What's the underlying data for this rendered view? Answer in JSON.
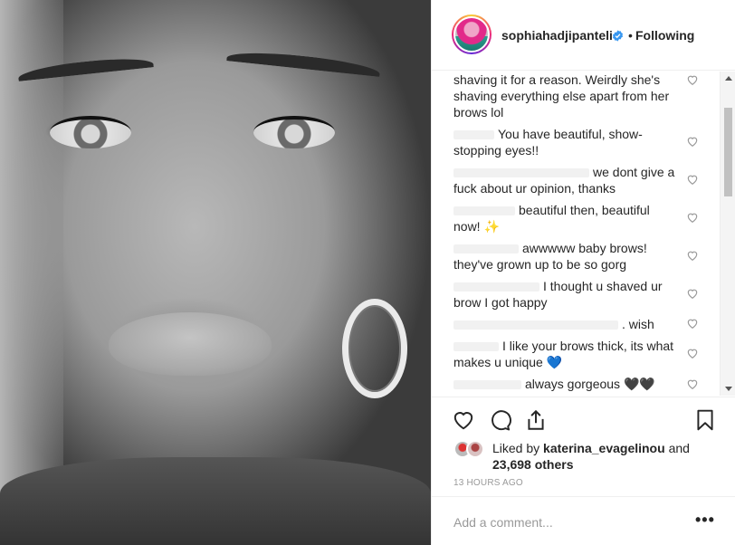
{
  "post": {
    "username": "sophiahadjipanteli",
    "separator": "•",
    "follow_status": "Following",
    "verified_color": "#3897f0"
  },
  "comments": [
    {
      "text": "shaving it for a reason. Weirdly she's shaving everything else apart from her brows lol"
    },
    {
      "text": "You have beautiful, show-stopping eyes!!"
    },
    {
      "text": "we dont give a fuck about ur opinion, thanks"
    },
    {
      "text": "beautiful then, beautiful now! ✨"
    },
    {
      "text": "awwwww baby brows! they've grown up to be so gorg"
    },
    {
      "text": "I thought u shaved ur brow I got happy"
    },
    {
      "text": ". wish"
    },
    {
      "text": "I like your brows thick, its what makes u unique 💙"
    },
    {
      "text": "always gorgeous 🖤🖤"
    }
  ],
  "likes": {
    "prefix": "Liked by",
    "user": "katerina_evagelinou",
    "conjunction": "and",
    "count": "23,698 others"
  },
  "timestamp": "13 HOURS AGO",
  "add_comment": {
    "placeholder": "Add a comment..."
  },
  "more_label": "•••",
  "icons": {
    "like": "heart-icon",
    "comment": "comment-icon",
    "share": "share-icon",
    "save": "bookmark-icon",
    "comment_like": "small-heart-icon"
  }
}
